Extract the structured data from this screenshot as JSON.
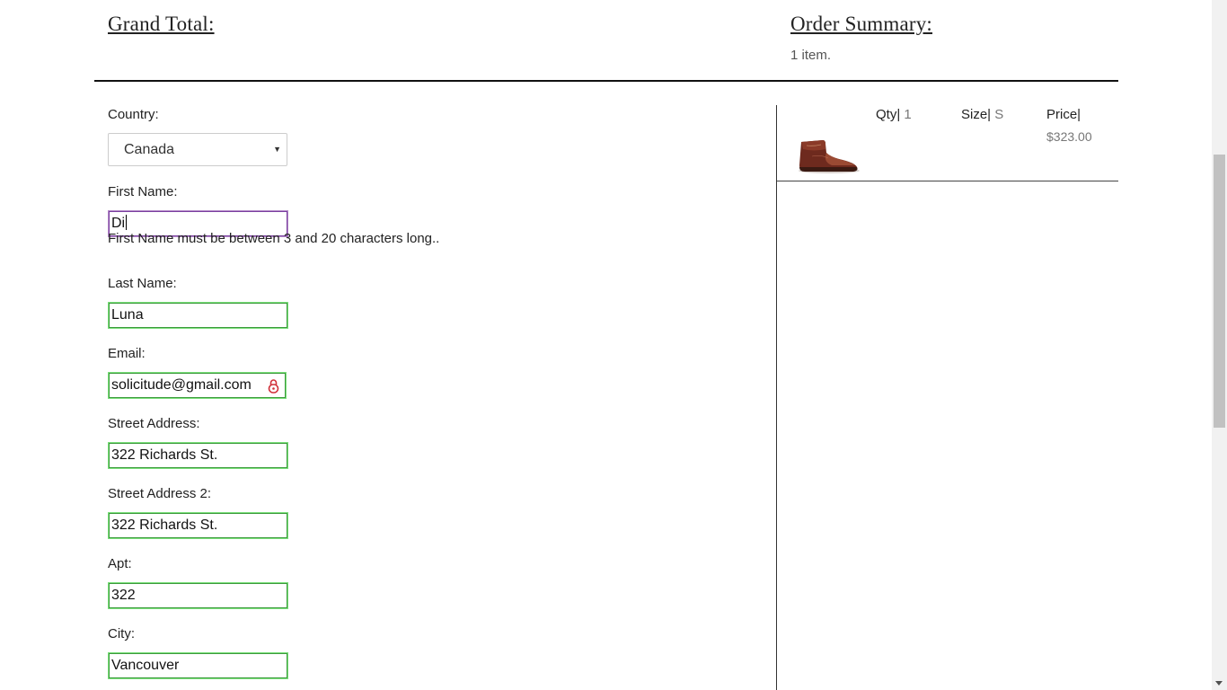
{
  "header": {
    "grand_total_title": "Grand Total:",
    "order_summary_title": "Order Summary:",
    "item_count": "1 item."
  },
  "form": {
    "country": {
      "label": "Country:",
      "value": "Canada"
    },
    "first_name": {
      "label": "First Name:",
      "value": "Di",
      "error": "First Name must be between 3 and 20 characters long.."
    },
    "last_name": {
      "label": "Last Name:",
      "value": "Luna"
    },
    "email": {
      "label": "Email:",
      "value": "solicitude@gmail.com",
      "icon": "password-manager-lock-icon"
    },
    "street": {
      "label": "Street Address:",
      "value": "322 Richards St."
    },
    "street2": {
      "label": "Street Address 2:",
      "value": "322 Richards St."
    },
    "apt": {
      "label": "Apt:",
      "value": "322"
    },
    "city": {
      "label": "City:",
      "value": "Vancouver"
    }
  },
  "summary": {
    "qty_label": "Qty|",
    "qty_value": "1",
    "size_label": "Size|",
    "size_value": "S",
    "price_label": "Price|",
    "price_value": "$323.00",
    "product_image": "brown-leather-chukka-boot"
  },
  "colors": {
    "valid_border": "#7be07b",
    "invalid_border": "#b48ac8",
    "lock_icon": "#d0303a"
  }
}
